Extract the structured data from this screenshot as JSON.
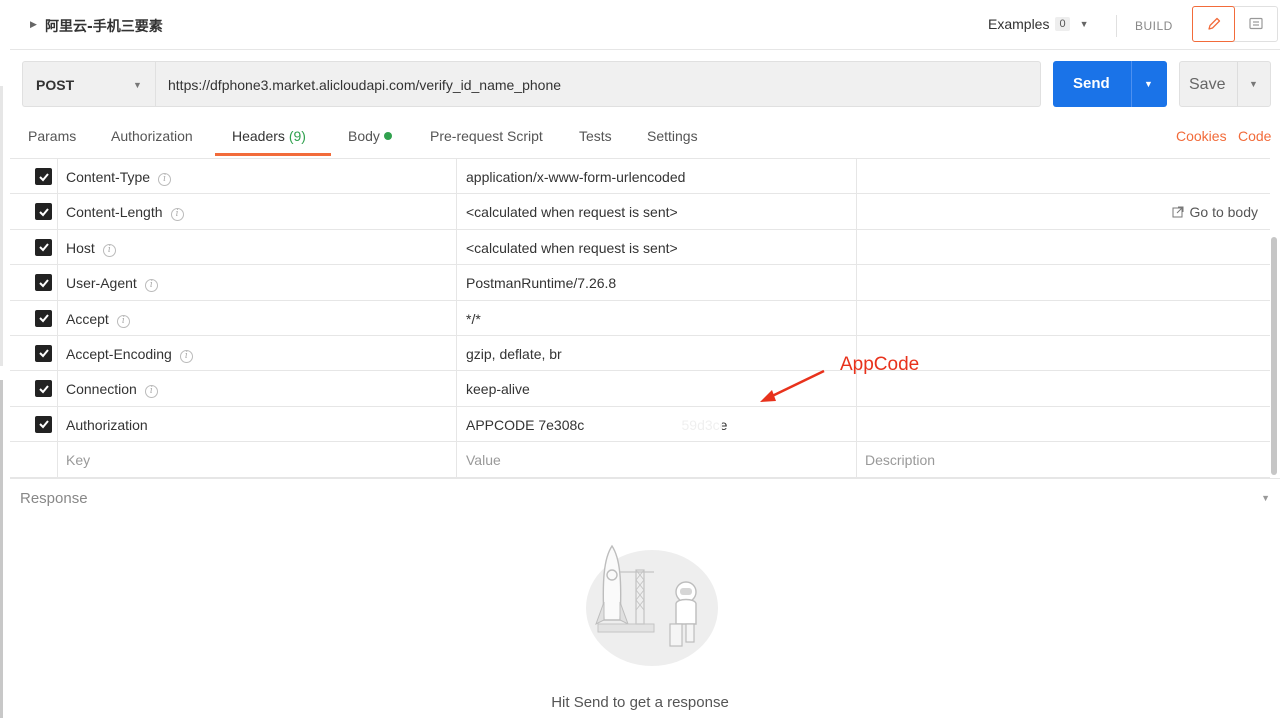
{
  "header": {
    "title": "阿里云-手机三要素",
    "examples_label": "Examples",
    "examples_count": "0",
    "build_label": "BUILD"
  },
  "request": {
    "method": "POST",
    "url": "https://dfphone3.market.alicloudapi.com/verify_id_name_phone",
    "send_label": "Send",
    "save_label": "Save"
  },
  "tabs": {
    "params": "Params",
    "authorization": "Authorization",
    "headers": "Headers",
    "headers_count": "(9)",
    "body": "Body",
    "prerequest": "Pre-request Script",
    "tests": "Tests",
    "settings": "Settings",
    "cookies": "Cookies",
    "code": "Code"
  },
  "headers_table": {
    "rows": [
      {
        "key": "Content-Type",
        "value": "application/x-www-form-urlencoded"
      },
      {
        "key": "Content-Length",
        "value": "<calculated when request is sent>"
      },
      {
        "key": "Host",
        "value": "<calculated when request is sent>"
      },
      {
        "key": "User-Agent",
        "value": "PostmanRuntime/7.26.8"
      },
      {
        "key": "Accept",
        "value": "*/*"
      },
      {
        "key": "Accept-Encoding",
        "value": "gzip, deflate, br"
      },
      {
        "key": "Connection",
        "value": "keep-alive"
      },
      {
        "key": "Authorization",
        "value": "APPCODE 7e308c                         59d3ce"
      }
    ],
    "go_to_body": "Go to body",
    "key_placeholder": "Key",
    "value_placeholder": "Value",
    "description_placeholder": "Description"
  },
  "annotation": {
    "text": "AppCode",
    "color": "#e8321c"
  },
  "response": {
    "label": "Response",
    "hint": "Hit Send to get a response"
  },
  "colors": {
    "accent": "#f26b3a",
    "send": "#1a73e8",
    "success": "#30a14e"
  }
}
